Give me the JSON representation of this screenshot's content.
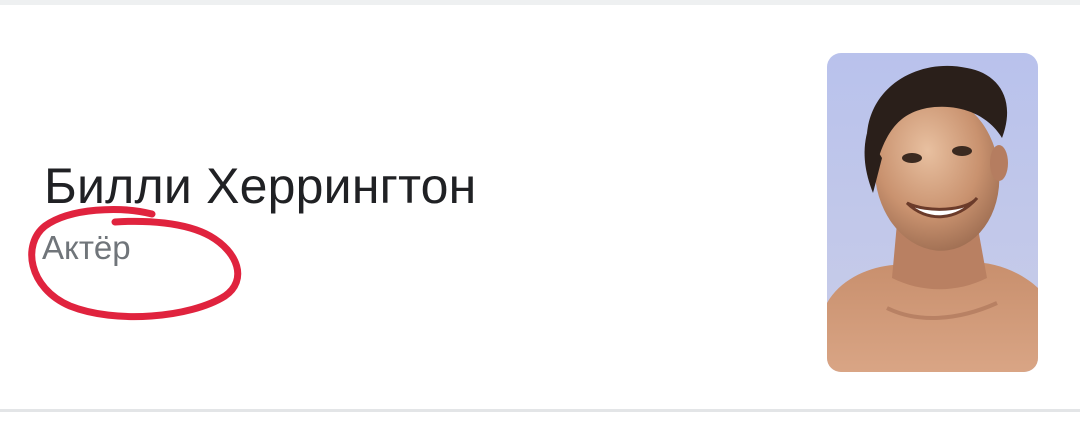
{
  "entity": {
    "name": "Билли Херрингтон",
    "description": "Актёр"
  },
  "colors": {
    "title": "#202124",
    "subtitle": "#70757a",
    "annotation": "#e0233e",
    "divider": "#e3e5e7"
  },
  "annotation": {
    "shape": "hand-drawn-circle",
    "target": "entity-description"
  },
  "thumbnail": {
    "icon": "person-photo"
  }
}
